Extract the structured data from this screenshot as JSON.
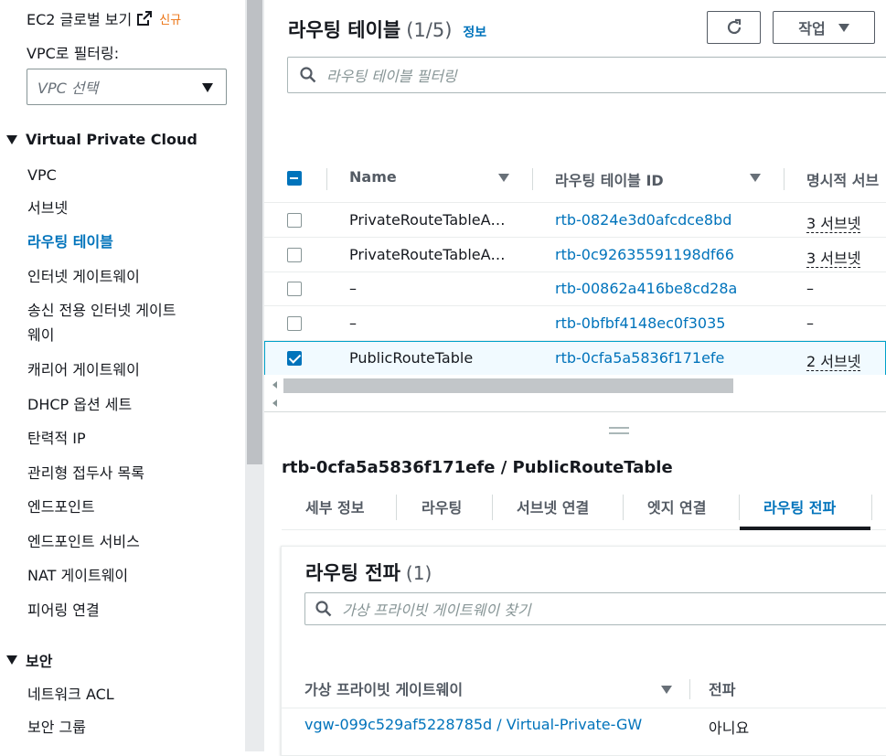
{
  "sidebar": {
    "ec2_global_view": "EC2 글로벌 보기",
    "new_badge": "신규",
    "vpc_filter_label": "VPC로 필터링:",
    "vpc_select_placeholder": "VPC 선택",
    "section_vpc": "Virtual Private Cloud",
    "items": [
      "VPC",
      "서브넷",
      "라우팅 테이블",
      "인터넷 게이트웨이",
      "송신 전용 인터넷 게이트",
      "웨이",
      "캐리어 게이트웨이",
      "DHCP 옵션 세트",
      "탄력적 IP",
      "관리형 접두사 목록",
      "엔드포인트",
      "엔드포인트 서비스",
      "NAT 게이트웨이",
      "피어링 연결"
    ],
    "section_security": "보안",
    "security_items": [
      "네트워크 ACL",
      "보안 그룹"
    ]
  },
  "main": {
    "title": "라우팅 테이블",
    "count": "(1/5)",
    "info": "정보",
    "actions_label": "작업",
    "search_placeholder": "라우팅 테이블 필터링",
    "columns": [
      "Name",
      "라우팅 테이블 ID",
      "명시적 서브"
    ],
    "rows": [
      {
        "name": "PrivateRouteTableA…",
        "id": "rtb-0824e3d0afcdce8bd",
        "subnets": "3 서브넷",
        "checked": false
      },
      {
        "name": "PrivateRouteTableA…",
        "id": "rtb-0c92635591198df66",
        "subnets": "3 서브넷",
        "checked": false
      },
      {
        "name": "–",
        "id": "rtb-00862a416be8cd28a",
        "subnets": "–",
        "checked": false
      },
      {
        "name": "–",
        "id": "rtb-0bfbf4148ec0f3035",
        "subnets": "–",
        "checked": false
      },
      {
        "name": "PublicRouteTable",
        "id": "rtb-0cfa5a5836f171efe",
        "subnets": "2 서브넷",
        "checked": true
      }
    ]
  },
  "detail": {
    "title": "rtb-0cfa5a5836f171efe / PublicRouteTable",
    "tabs": [
      "세부 정보",
      "라우팅",
      "서브넷 연결",
      "엣지 연결",
      "라우팅 전파"
    ],
    "panel_title": "라우팅 전파",
    "panel_count": "(1)",
    "panel_search_placeholder": "가상 프라이빗 게이트웨이 찾기",
    "panel_columns": [
      "가상 프라이빗 게이트웨이",
      "전파"
    ],
    "panel_row": {
      "gateway": "vgw-099c529af5228785d / Virtual-Private-GW",
      "propagation": "아니요"
    }
  },
  "colors": {
    "link": "#0073bb",
    "badge_new": "#ec7211"
  }
}
